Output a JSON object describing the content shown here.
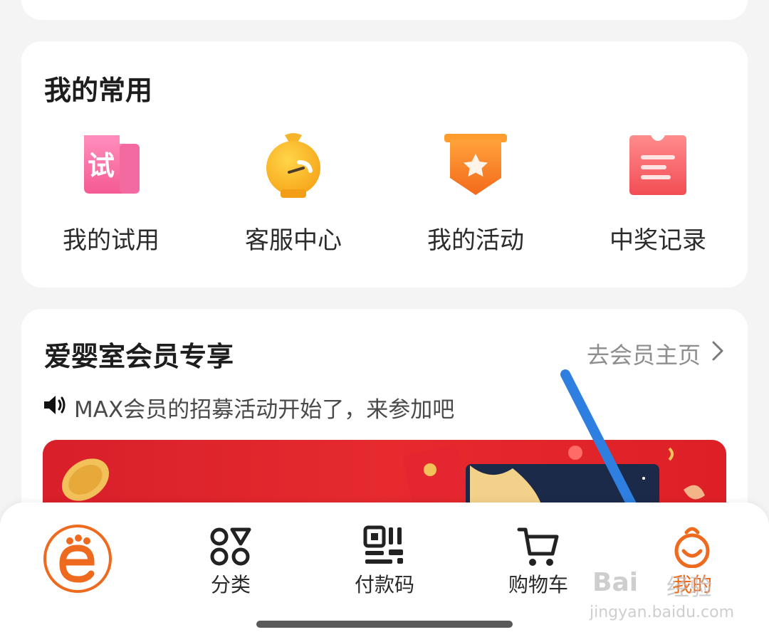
{
  "common": {
    "title": "我的常用",
    "items": [
      {
        "label": "我的试用",
        "icon": "trial-icon",
        "glyph": "试"
      },
      {
        "label": "客服中心",
        "icon": "customer-service-icon"
      },
      {
        "label": "我的活动",
        "icon": "activity-badge-icon"
      },
      {
        "label": "中奖记录",
        "icon": "prize-record-icon"
      }
    ]
  },
  "member": {
    "title": "爱婴室会员专享",
    "link_label": "去会员主页",
    "notice": "MAX会员的招募活动开始了，来参加吧"
  },
  "tabbar": {
    "items": [
      {
        "label": "",
        "icon": "home-logo-icon"
      },
      {
        "label": "分类",
        "icon": "category-icon"
      },
      {
        "label": "付款码",
        "icon": "payment-code-icon"
      },
      {
        "label": "购物车",
        "icon": "cart-icon"
      },
      {
        "label": "我的",
        "icon": "profile-icon",
        "active": true
      }
    ]
  },
  "watermark": {
    "brand": "Bai",
    "brand_suffix": "经验",
    "url": "jingyan.baidu.com"
  },
  "colors": {
    "accent": "#ee6a1f",
    "banner_red": "#e02a2e",
    "arrow_blue": "#2f7fe0",
    "background": "#f4f4f4"
  }
}
